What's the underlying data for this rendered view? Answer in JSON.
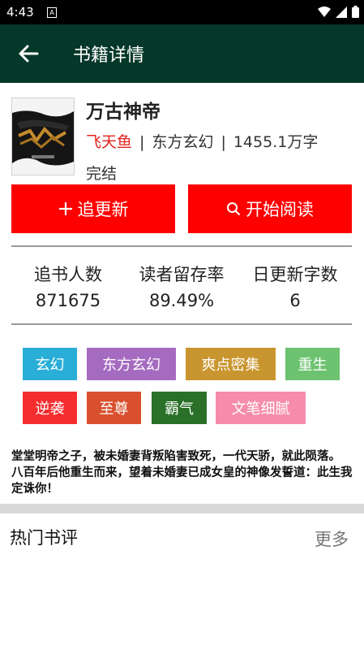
{
  "status_bar": {
    "time": "4:43",
    "sim_label": "A",
    "wifi_icon": "wifi-icon",
    "signal_icon": "signal-icon",
    "battery_icon": "battery-icon"
  },
  "app_bar": {
    "back_icon": "arrow-left-icon",
    "title": "书籍详情"
  },
  "book": {
    "cover_icon": "book-cover-image",
    "title": "万古神帝",
    "author": "飞天鱼",
    "separator": "|",
    "genre": "东方玄幻",
    "word_count": "1455.1万字",
    "status": "完结"
  },
  "actions": {
    "follow": {
      "icon": "plus-icon",
      "label": "追更新"
    },
    "read": {
      "icon": "search-icon",
      "label": "开始阅读"
    }
  },
  "stats": [
    {
      "label": "追书人数",
      "value": "871675"
    },
    {
      "label": "读者留存率",
      "value": "89.49%"
    },
    {
      "label": "日更新字数",
      "value": "6"
    }
  ],
  "tags": [
    {
      "label": "玄幻",
      "color": "#29aed7"
    },
    {
      "label": "东方玄幻",
      "color": "#a56bc0"
    },
    {
      "label": "爽点密集",
      "color": "#c9952e"
    },
    {
      "label": "重生",
      "color": "#6dc26f"
    },
    {
      "label": "逆袭",
      "color": "#f42e2e"
    },
    {
      "label": "至尊",
      "color": "#d9502e"
    },
    {
      "label": "霸气",
      "color": "#2a7028"
    },
    {
      "label": "文笔细腻",
      "color": "#f58cab"
    }
  ],
  "summary": "堂堂明帝之子，被未婚妻背叛陷害致死，一代天骄，就此陨落。 八百年后他重生而来，望着未婚妻已成女皇的神像发誓道：此生我定诛你！",
  "comments": {
    "title": "热门书评",
    "more": "更多"
  },
  "colors": {
    "app_bar": "#06382a",
    "button": "#fe0000",
    "author": "#e3221c"
  }
}
